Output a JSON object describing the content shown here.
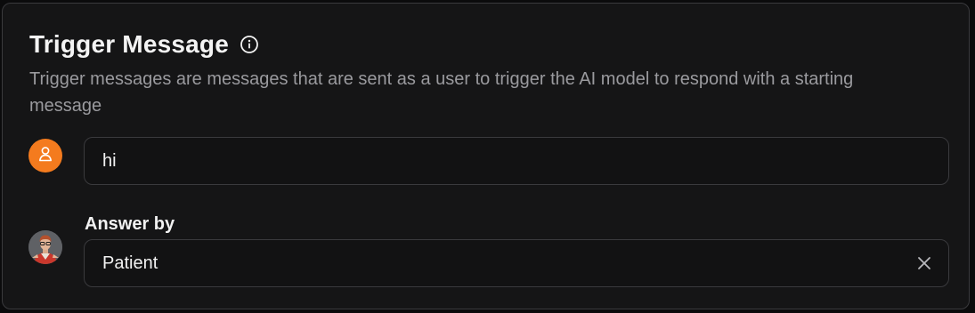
{
  "section": {
    "title": "Trigger Message",
    "description": "Trigger messages are messages that are sent as a user to trigger the AI model to respond with a starting message"
  },
  "trigger": {
    "value": "hi"
  },
  "answer": {
    "label": "Answer by",
    "value": "Patient"
  },
  "colors": {
    "user_avatar_bg": "#f47b1e",
    "card_bg": "#151516",
    "border": "#3a3a3d",
    "muted_text": "#9a9a9e"
  },
  "icons": {
    "info": "info-circle-icon",
    "user": "user-icon",
    "clear": "close-icon"
  }
}
